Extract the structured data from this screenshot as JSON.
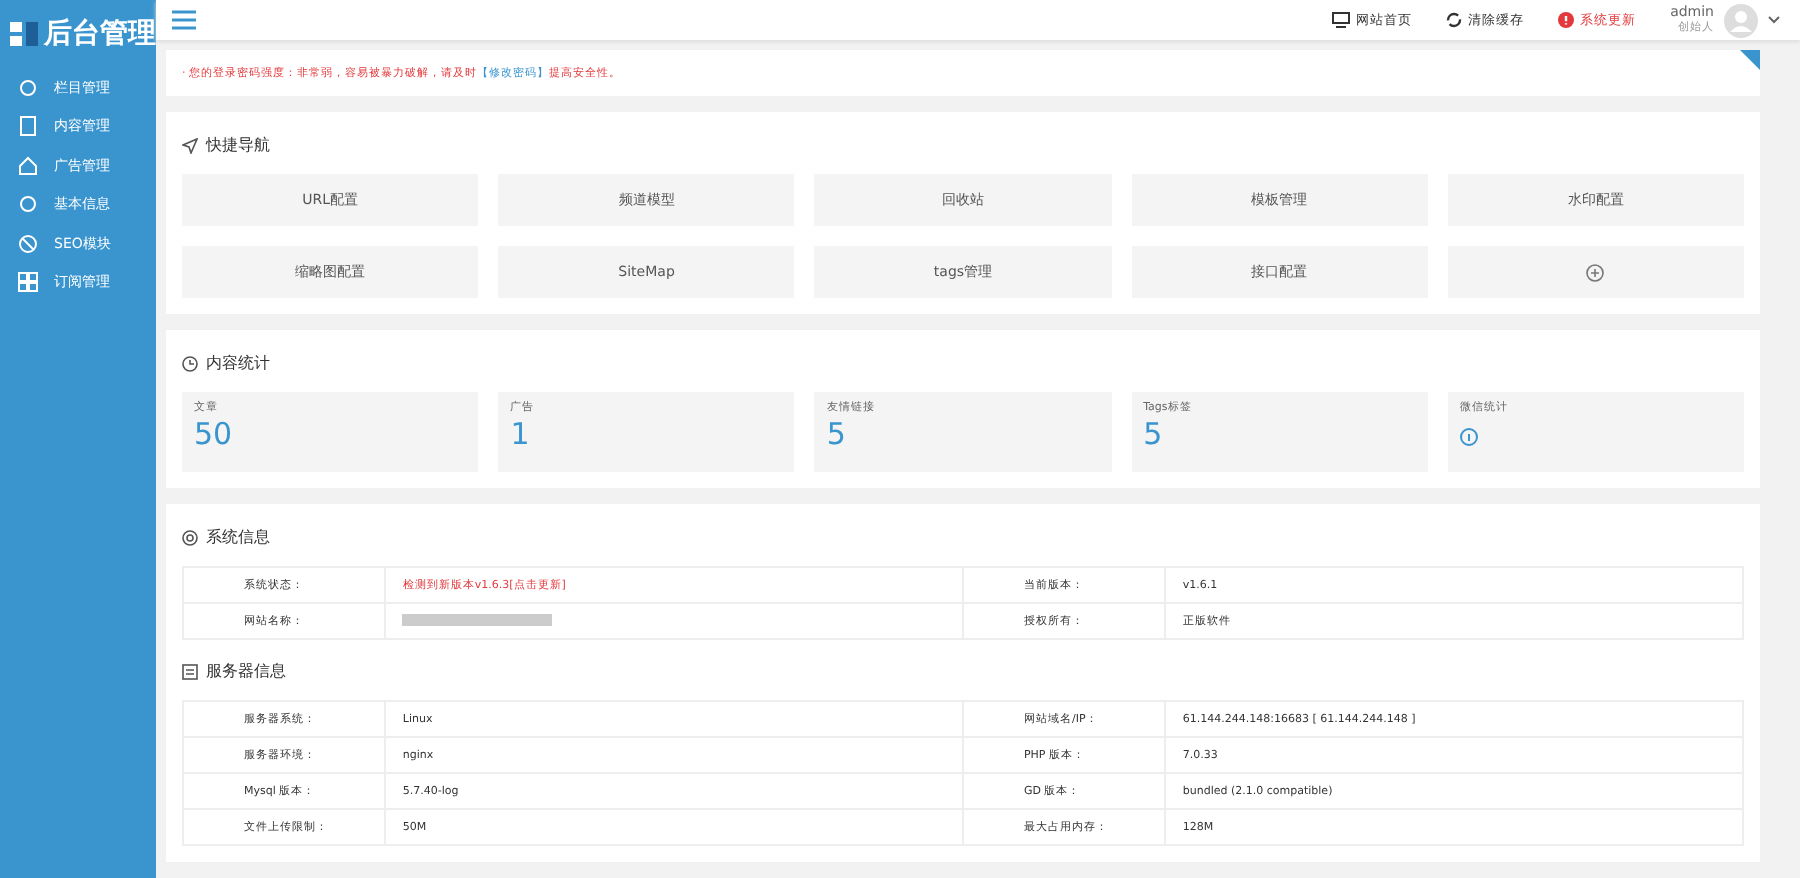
{
  "sidebar": {
    "logo": "后台管理",
    "items": [
      {
        "label": "栏目管理",
        "kind": "gear",
        "selected": false
      },
      {
        "label": "内容管理",
        "kind": "doc",
        "selected": false
      },
      {
        "label": "广告管理",
        "kind": "home",
        "selected": false
      },
      {
        "label": "基本信息",
        "kind": "gear",
        "selected": false
      },
      {
        "label": "SEO模块",
        "kind": "ban",
        "selected": false
      },
      {
        "label": "订阅管理",
        "kind": "grid",
        "selected": false
      }
    ]
  },
  "header": {
    "links": [
      {
        "label": "网站首页",
        "kind": "monitor"
      },
      {
        "label": "清除缓存",
        "kind": "refresh"
      },
      {
        "label": "系统更新",
        "kind": "alert"
      }
    ],
    "user": {
      "name": "admin",
      "role": "创始人"
    }
  },
  "notice": {
    "text": "· 您的登录密码强度：非常弱，容易被暴力破解，请及时",
    "link": "【修改密码】",
    "after": "提高安全性。"
  },
  "quick_nav": {
    "title": "快捷导航",
    "items": [
      {
        "label": "URL配置",
        "kind": "text"
      },
      {
        "label": "频道模型",
        "kind": "text"
      },
      {
        "label": "回收站",
        "kind": "text"
      },
      {
        "label": "模板管理",
        "kind": "text"
      },
      {
        "label": "水印配置",
        "kind": "text"
      },
      {
        "label": "缩略图配置",
        "kind": "text"
      },
      {
        "label": "SiteMap",
        "kind": "text"
      },
      {
        "label": "tags管理",
        "kind": "text"
      },
      {
        "label": "接口配置",
        "kind": "text"
      },
      {
        "kind": "add"
      }
    ]
  },
  "stats": {
    "title": "内容统计",
    "items": [
      {
        "label": "文章",
        "value": "50",
        "kind": "number"
      },
      {
        "label": "广告",
        "value": "1",
        "kind": "number"
      },
      {
        "label": "友情链接",
        "value": "5",
        "kind": "number"
      },
      {
        "label": "Tags标签",
        "value": "5",
        "kind": "number"
      },
      {
        "label": "微信统计",
        "kind": "icon"
      }
    ]
  },
  "system_info": {
    "title": "系统信息",
    "rows": [
      [
        {
          "label": "系统状态：",
          "value": "检测到新版本v1.6.3[点击更新]",
          "kind": "alert"
        },
        {
          "label": "当前版本：",
          "value": "v1.6.1",
          "kind": "text"
        }
      ],
      [
        {
          "label": "网站名称：",
          "kind": "blurred"
        },
        {
          "label": "授权所有：",
          "value": "正版软件",
          "kind": "text"
        }
      ]
    ]
  },
  "server_info": {
    "title": "服务器信息",
    "rows": [
      [
        {
          "label": "服务器系统：",
          "value": "Linux"
        },
        {
          "label": "网站域名/IP：",
          "value": "61.144.244.148:16683 [ 61.144.244.148 ]"
        }
      ],
      [
        {
          "label": "服务器环境：",
          "value": "nginx"
        },
        {
          "label": "PHP 版本：",
          "value": "7.0.33"
        }
      ],
      [
        {
          "label": "Mysql 版本：",
          "value": "5.7.40-log"
        },
        {
          "label": "GD 版本：",
          "value": "bundled (2.1.0 compatible)"
        }
      ],
      [
        {
          "label": "文件上传限制：",
          "value": "50M"
        },
        {
          "label": "最大占用内存：",
          "value": "128M"
        }
      ]
    ]
  }
}
